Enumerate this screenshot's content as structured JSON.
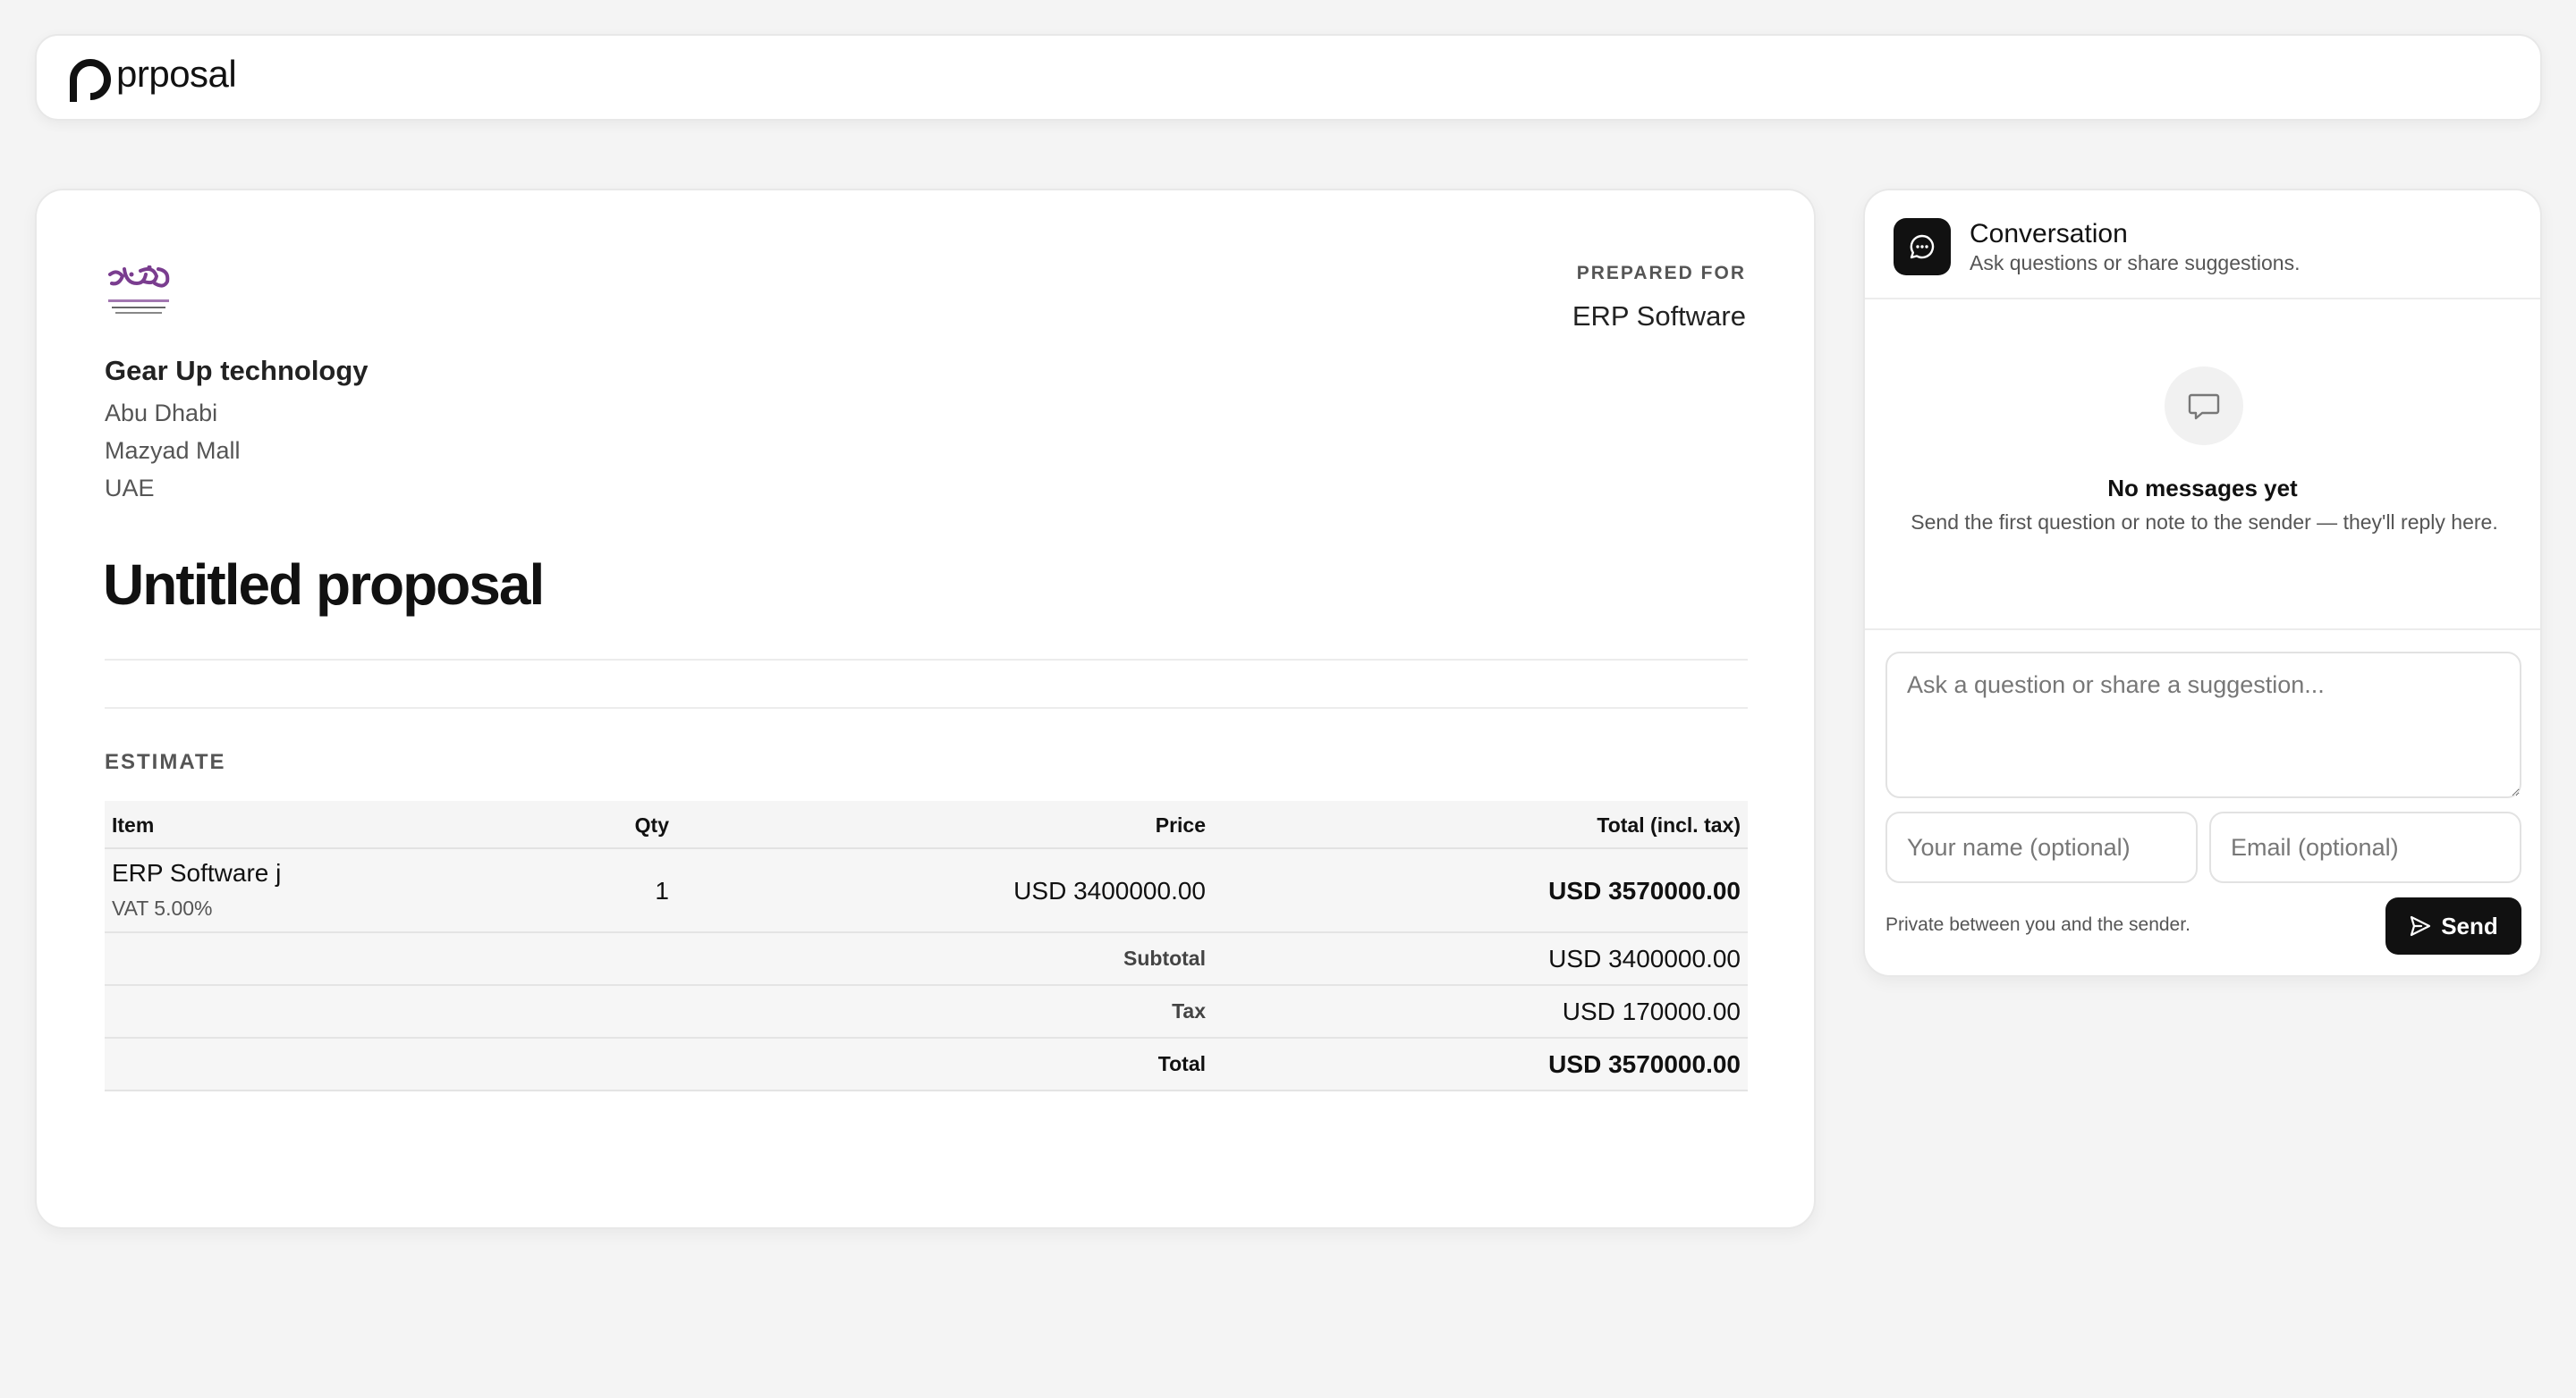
{
  "brand": {
    "name": "prposal"
  },
  "proposal": {
    "prepared_for_label": "PREPARED FOR",
    "prepared_for": "ERP Software",
    "company": {
      "name": "Gear Up technology",
      "address": [
        "Abu Dhabi",
        "Mazyad Mall",
        "UAE"
      ]
    },
    "title": "Untitled proposal",
    "estimate_label": "ESTIMATE",
    "table": {
      "headers": {
        "item": "Item",
        "qty": "Qty",
        "price": "Price",
        "total": "Total (incl. tax)"
      },
      "rows": [
        {
          "item": "ERP Software j",
          "tax_note": "VAT 5.00%",
          "qty": "1",
          "price": "USD 3400000.00",
          "total": "USD 3570000.00"
        }
      ],
      "subtotal": {
        "label": "Subtotal",
        "value": "USD 3400000.00"
      },
      "tax": {
        "label": "Tax",
        "value": "USD 170000.00"
      },
      "total": {
        "label": "Total",
        "value": "USD 3570000.00"
      }
    }
  },
  "conversation": {
    "title": "Conversation",
    "subtitle": "Ask questions or share suggestions.",
    "empty_title": "No messages yet",
    "empty_desc": "Send the first question or note to the sender — they'll reply here.",
    "message_placeholder": "Ask a question or share a suggestion...",
    "name_placeholder": "Your name (optional)",
    "email_placeholder": "Email (optional)",
    "privacy_note": "Private between you and the sender.",
    "send_label": "Send"
  },
  "colors": {
    "accent": "#111111",
    "logo": "#7a3d8f",
    "background": "#f4f4f4"
  },
  "icons": {
    "brand": "brand-p-icon",
    "conversation": "chat-bubble-icon",
    "empty": "message-square-icon",
    "send": "send-icon"
  }
}
